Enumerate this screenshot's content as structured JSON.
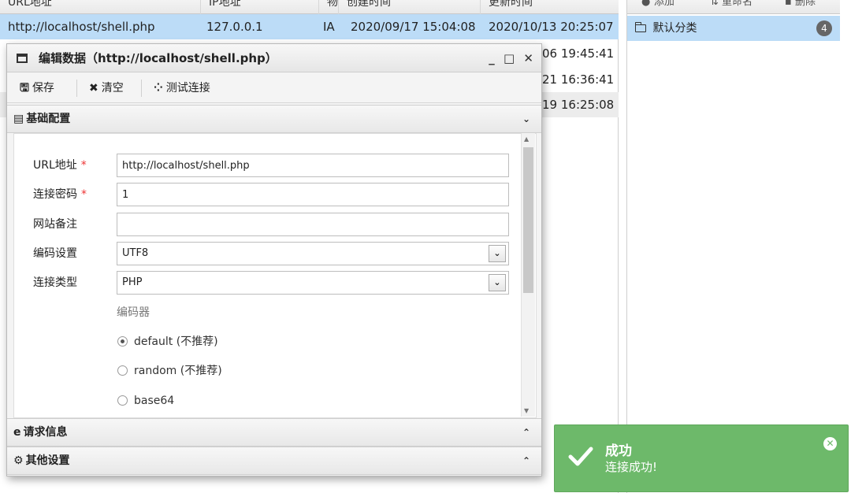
{
  "grid": {
    "columns": [
      "URL地址",
      "IP地址",
      "物",
      "创建时间",
      "更新时间"
    ],
    "rows": [
      {
        "url": "http://localhost/shell.php",
        "ip": "127.0.0.1",
        "loc": "IA",
        "created": "2020/09/17 15:04:08",
        "updated": "2020/10/13 20:25:07"
      },
      {
        "updated": "06 19:45:41"
      },
      {
        "updated": "21 16:36:41"
      },
      {
        "updated": "19 16:25:08"
      }
    ]
  },
  "category": {
    "toolbar": [
      "添加",
      "重命名",
      "删除"
    ],
    "item_label": "默认分类",
    "item_count": "4"
  },
  "dialog": {
    "title": "编辑数据（http://localhost/shell.php）",
    "toolbar": {
      "save": "保存",
      "clear": "清空",
      "test": "测试连接"
    },
    "sections": {
      "basic": "基础配置",
      "request": "请求信息",
      "other": "其他设置"
    },
    "form": {
      "url_label": "URL地址",
      "url_value": "http://localhost/shell.php",
      "password_label": "连接密码",
      "password_value": "1",
      "note_label": "网站备注",
      "note_value": "",
      "encoding_label": "编码设置",
      "encoding_value": "UTF8",
      "type_label": "连接类型",
      "type_value": "PHP",
      "encoder_label": "编码器",
      "encoders": [
        "default (不推荐)",
        "random (不推荐)",
        "base64"
      ],
      "selected_encoder": "default (不推荐)",
      "required_mark": "*"
    }
  },
  "toast": {
    "title": "成功",
    "message": "连接成功!",
    "color": "#6db96a"
  }
}
